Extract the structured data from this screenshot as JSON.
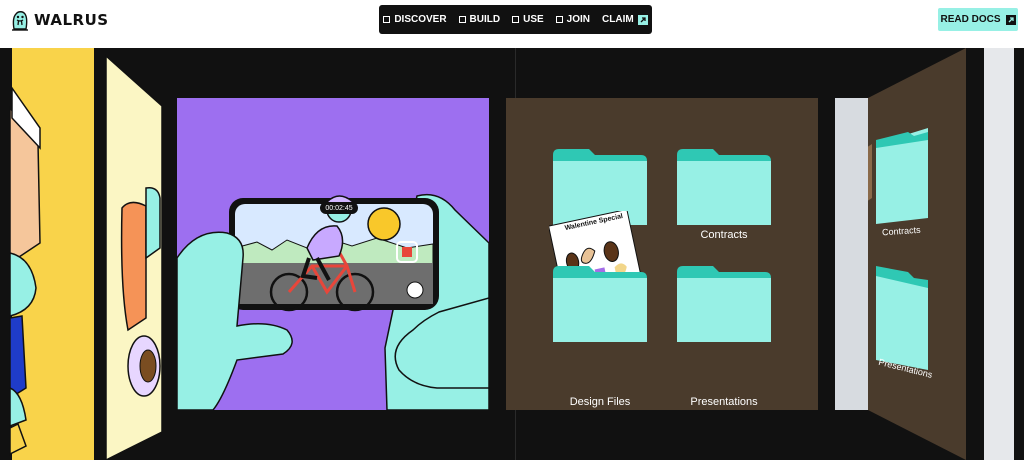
{
  "brand": {
    "name": "WALRUS",
    "icon": "walrus-logo-icon"
  },
  "nav": {
    "items": [
      {
        "label": "DISCOVER",
        "icon": "square-icon"
      },
      {
        "label": "BUILD",
        "icon": "square-icon"
      },
      {
        "label": "USE",
        "icon": "square-icon"
      },
      {
        "label": "JOIN",
        "icon": "square-icon"
      },
      {
        "label": "CLAIM",
        "icon": "external-arrow-icon"
      }
    ]
  },
  "docs_button": {
    "label": "READ DOCS",
    "icon": "external-arrow-icon"
  },
  "video_card": {
    "timer": "00:02:45"
  },
  "folders_card": {
    "sticker": {
      "title": "Walentine Special"
    },
    "folders": [
      {
        "label": ""
      },
      {
        "label": "Contracts"
      },
      {
        "label": "Design Files"
      },
      {
        "label": "Presentations"
      }
    ]
  },
  "side_panel": {
    "folders": [
      {
        "label": "Contracts"
      },
      {
        "label": "Presentations"
      }
    ]
  },
  "colors": {
    "accent": "#97f0e5",
    "purple": "#9d6ff0",
    "brown": "#4a3b2c",
    "yellow": "#f9d34a",
    "dark": "#111111"
  }
}
